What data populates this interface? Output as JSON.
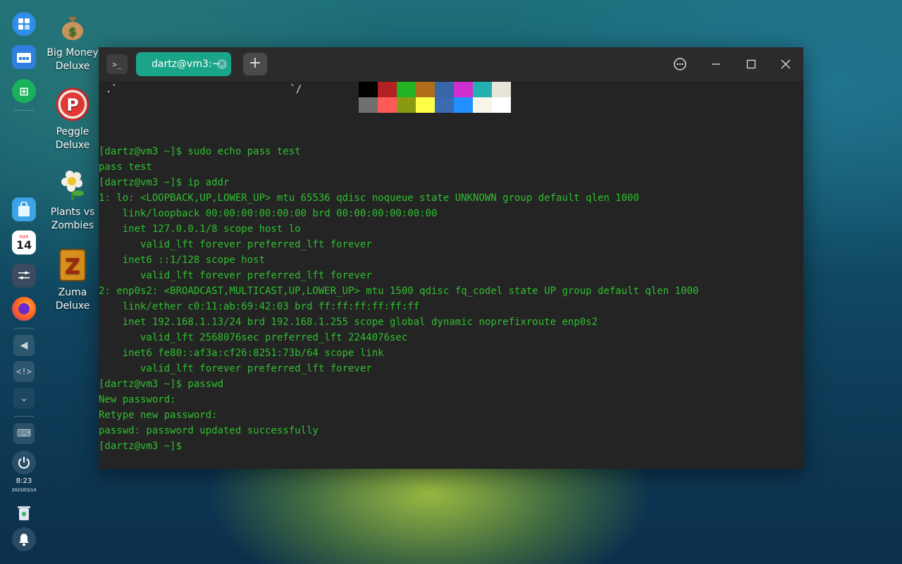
{
  "desktop": {
    "icons": [
      {
        "line1": "Big Money",
        "line2": "Deluxe",
        "icon": "money-bag-icon"
      },
      {
        "line1": "Peggle",
        "line2": "Deluxe",
        "icon": "peggle-icon"
      },
      {
        "line1": "Plants vs",
        "line2": "Zombies",
        "icon": "flower-icon"
      },
      {
        "line1": "Zuma",
        "line2": "Deluxe",
        "icon": "zuma-icon"
      }
    ]
  },
  "dock": {
    "calendar_day": "14",
    "time": "8:23",
    "date": "2023/03/14",
    "items": [
      "launcher-icon",
      "file-manager-icon",
      "app-store-icon",
      "app-store-bag-icon",
      "calendar-icon",
      "control-center-icon",
      "firefox-icon",
      "volume-icon",
      "dev-icon",
      "chevron-down-icon",
      "keyboard-icon",
      "power-icon",
      "trash-icon",
      "bell-icon"
    ]
  },
  "terminal": {
    "tab_title": "dartz@vm3:~",
    "tab_close": "×",
    "new_tab": "+",
    "menu_icon": "⋯",
    "term_icon_label": ">_",
    "neofetch_art": ".`                             `/",
    "palette_top": [
      "#000000",
      "#b22222",
      "#22b222",
      "#b06d1a",
      "#3866a8",
      "#d02fd0",
      "#22b0b0",
      "#e8e4d8"
    ],
    "palette_bottom": [
      "#707070",
      "#ff5a5a",
      "#8a9a10",
      "#ffff4a",
      "#3a6ab0",
      "#2090ff",
      "#f8f4e8",
      "#ffffff"
    ],
    "lines": [
      "[dartz@vm3 ~]$ sudo echo pass test",
      "pass test",
      "[dartz@vm3 ~]$ ip addr",
      "1: lo: <LOOPBACK,UP,LOWER_UP> mtu 65536 qdisc noqueue state UNKNOWN group default qlen 1000",
      "    link/loopback 00:00:00:00:00:00 brd 00:00:00:00:00:00",
      "    inet 127.0.0.1/8 scope host lo",
      "       valid_lft forever preferred_lft forever",
      "    inet6 ::1/128 scope host",
      "       valid_lft forever preferred_lft forever",
      "2: enp0s2: <BROADCAST,MULTICAST,UP,LOWER_UP> mtu 1500 qdisc fq_codel state UP group default qlen 1000",
      "    link/ether c0:11:ab:69:42:03 brd ff:ff:ff:ff:ff:ff",
      "    inet 192.168.1.13/24 brd 192.168.1.255 scope global dynamic noprefixroute enp0s2",
      "       valid_lft 2568076sec preferred_lft 2244076sec",
      "    inet6 fe80::af3a:cf26:8251:73b/64 scope link",
      "       valid_lft forever preferred_lft forever",
      "[dartz@vm3 ~]$ passwd",
      "New password:",
      "Retype new password:",
      "passwd: password updated successfully",
      "[dartz@vm3 ~]$"
    ]
  }
}
